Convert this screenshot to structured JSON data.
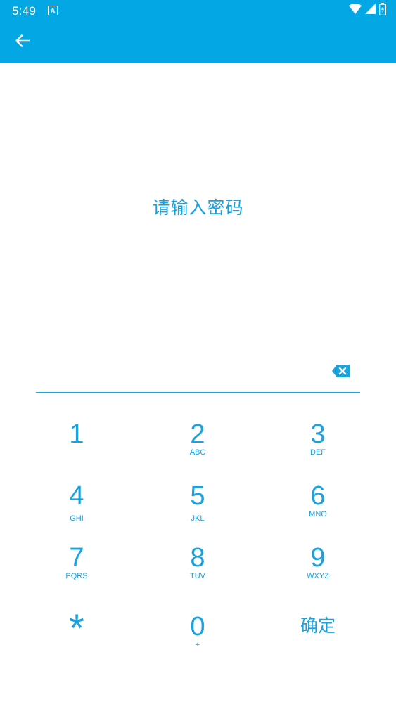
{
  "status_bar": {
    "time": "5:49",
    "notification_icon": "a-notification-icon"
  },
  "app_bar": {
    "back_icon": "arrow-left-icon"
  },
  "prompt": "请输入密码",
  "password": {
    "value": "",
    "delete_icon": "backspace-icon"
  },
  "keypad": {
    "keys": [
      {
        "digit": "1",
        "letters": ""
      },
      {
        "digit": "2",
        "letters": "ABC"
      },
      {
        "digit": "3",
        "letters": "DEF"
      },
      {
        "digit": "4",
        "letters": "GHI"
      },
      {
        "digit": "5",
        "letters": "JKL"
      },
      {
        "digit": "6",
        "letters": "MNO"
      },
      {
        "digit": "7",
        "letters": "PQRS"
      },
      {
        "digit": "8",
        "letters": "TUV"
      },
      {
        "digit": "9",
        "letters": "WXYZ"
      }
    ],
    "star": "*",
    "zero": {
      "digit": "0",
      "letters": "+"
    },
    "confirm": "确定"
  },
  "colors": {
    "app_bar": "#03a7e4",
    "accent": "#1aa2df",
    "background": "#ffffff"
  }
}
